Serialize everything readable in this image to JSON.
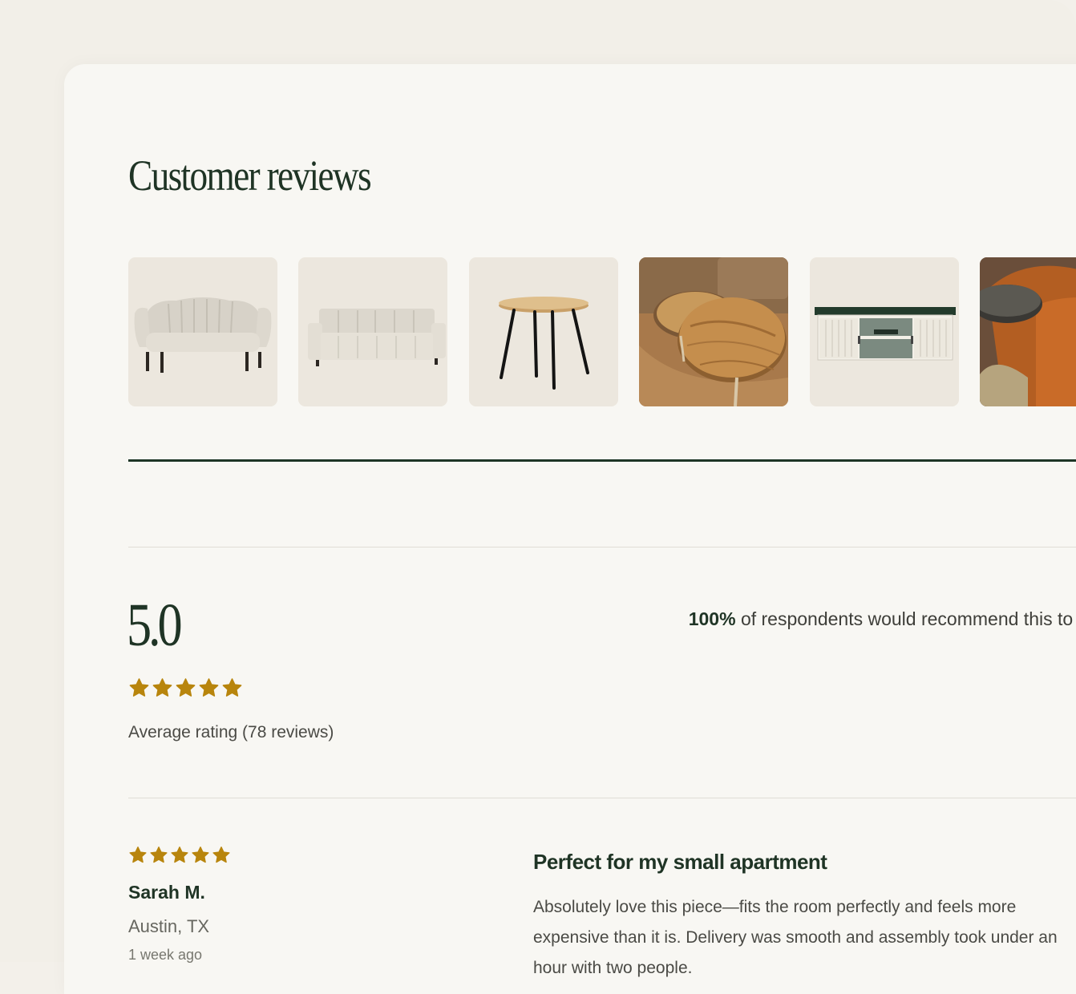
{
  "reviews_section": {
    "title": "Customer reviews",
    "photos": [
      {
        "subject": "cream channel-tufted loveseat"
      },
      {
        "subject": "off-white three-seat sofa"
      },
      {
        "subject": "round wooden side table with black legs"
      },
      {
        "subject": "round wooden coffee tables in living room"
      },
      {
        "subject": "white TV console with dark green top"
      },
      {
        "subject": "orange armchair in living room"
      }
    ]
  },
  "summary": {
    "average_score": "5.0",
    "star_rating": 5,
    "average_label": "Average rating (78 reviews)",
    "recommend_percent": "100%",
    "recommend_text": "of respondents would recommend this to a friend"
  },
  "reviews": [
    {
      "stars": 5,
      "name": "Sarah M.",
      "location": "Austin, TX",
      "date": "1 week ago",
      "title": "Perfect for my small apartment",
      "body": "Absolutely love this piece—fits the room perfectly and feels more expensive than it is. Delivery was smooth and assembly took under an hour with two people."
    }
  ],
  "colors": {
    "accent_green": "#1f3425",
    "star_gold": "#b8850d",
    "page_background": "#f2efe8",
    "card_background": "#f8f7f3"
  },
  "icons": {
    "rating_star": "star-icon"
  }
}
